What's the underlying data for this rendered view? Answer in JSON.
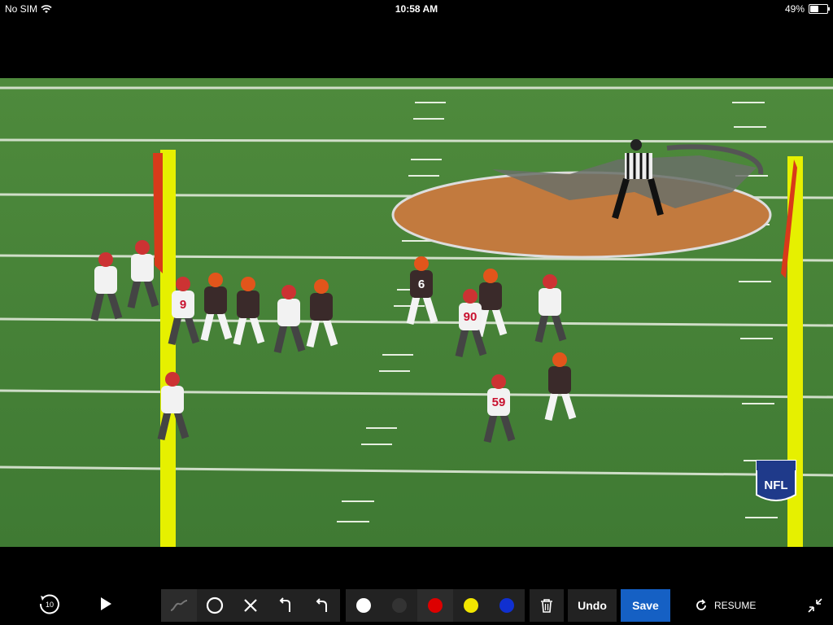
{
  "status_bar": {
    "carrier": "No SIM",
    "time": "10:58 AM",
    "battery_percent": "49%",
    "battery_level": 0.49
  },
  "video": {
    "player_numbers": [
      "6",
      "90",
      "59",
      "9"
    ],
    "watermark": "NFL"
  },
  "toolbar": {
    "replay_seconds": "10",
    "draw_tools": [
      "freehand-icon",
      "circle-icon",
      "x-mark-icon",
      "route-right-icon",
      "route-left-icon"
    ],
    "colors": [
      {
        "name": "white",
        "hex": "#ffffff"
      },
      {
        "name": "black",
        "hex": "#333333"
      },
      {
        "name": "red",
        "hex": "#dd0000"
      },
      {
        "name": "yellow",
        "hex": "#f2e600"
      },
      {
        "name": "blue",
        "hex": "#1030d0"
      }
    ],
    "undo_label": "Undo",
    "save_label": "Save",
    "resume_label": "RESUME",
    "save_color": "#1560c4"
  }
}
